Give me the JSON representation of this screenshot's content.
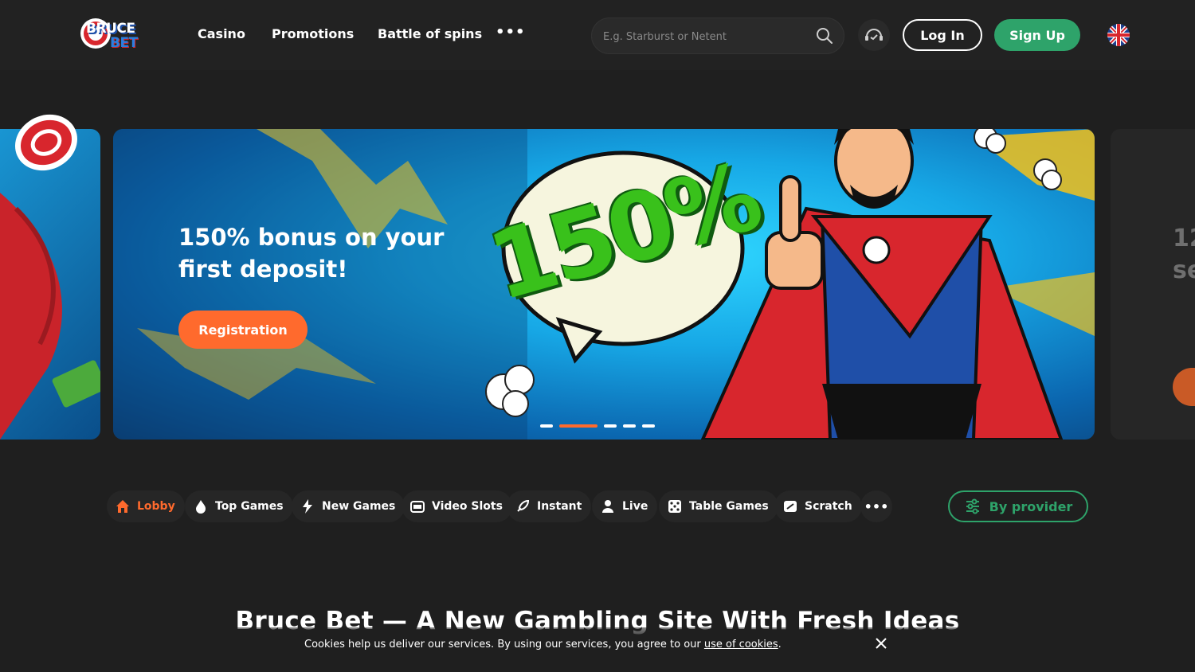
{
  "header": {
    "logo_text_top": "BRUCE",
    "logo_text_bottom": "BET",
    "nav": [
      "Casino",
      "Promotions",
      "Battle of spins"
    ],
    "search_placeholder": "E.g. Starburst or Netent",
    "login_label": "Log In",
    "signup_label": "Sign Up",
    "language": "English (UK flag)"
  },
  "carousel": {
    "main_title": "150% bonus on your first deposit!",
    "bubble_text": "150%",
    "cta_label": "Registration",
    "right_peek_text_1": "12",
    "right_peek_text_2": "se",
    "active_dot": 1,
    "dot_count": 5
  },
  "categories": {
    "items": [
      "Lobby",
      "Top Games",
      "New Games",
      "Video Slots",
      "Instant",
      "Live",
      "Table Games",
      "Scratch"
    ],
    "active": "Lobby",
    "provider_label": "By provider"
  },
  "main": {
    "heading": "Bruce Bet — A New Gambling Site With Fresh Ideas"
  },
  "cookie": {
    "text": "Cookies help us deliver our services. By using our services, you agree to our ",
    "link_text": "use of cookies",
    "suffix": "."
  },
  "colors": {
    "accent_orange": "#ff6a2d",
    "accent_green": "#2ea36a",
    "background": "#1f1f1f"
  }
}
